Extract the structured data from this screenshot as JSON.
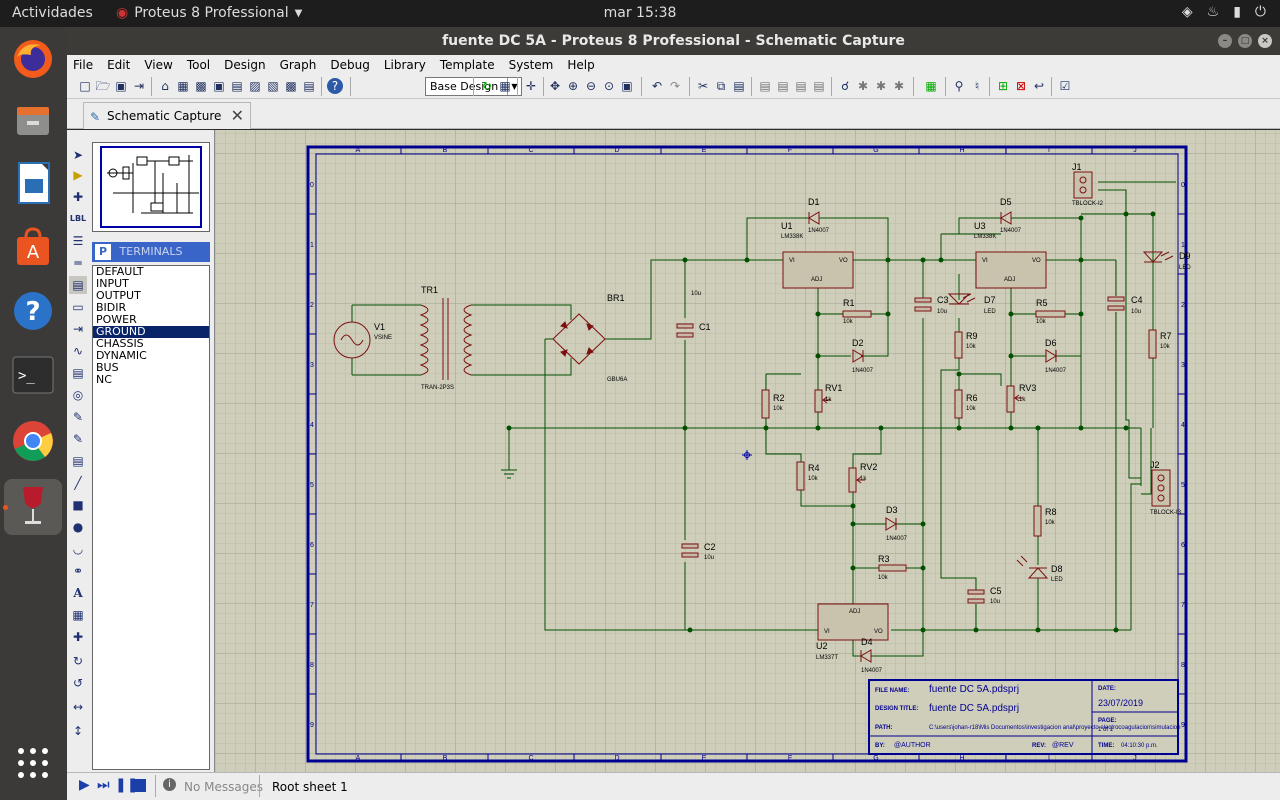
{
  "topbar": {
    "activities": "Actividades",
    "app_name": "Proteus 8 Professional",
    "clock": "mar 15:38",
    "tray_icons": [
      "wifi-icon",
      "volume-icon",
      "battery-icon",
      "power-icon"
    ]
  },
  "dock": {
    "items": [
      "firefox-icon",
      "files-icon",
      "libreoffice-impress-icon",
      "software-center-icon",
      "help-icon",
      "terminal-icon",
      "chrome-icon",
      "wine-icon",
      "app-grid-icon"
    ]
  },
  "window": {
    "title": "fuente DC 5A - Proteus 8 Professional - Schematic Capture"
  },
  "menu": [
    "File",
    "Edit",
    "View",
    "Tool",
    "Design",
    "Graph",
    "Debug",
    "Library",
    "Template",
    "System",
    "Help"
  ],
  "toolbar": {
    "layer_select": "Base Design"
  },
  "tab": {
    "label": "Schematic Capture"
  },
  "panel": {
    "mode_letter": "P",
    "header": "TERMINALS",
    "items": [
      "DEFAULT",
      "INPUT",
      "OUTPUT",
      "BIDIR",
      "POWER",
      "GROUND",
      "CHASSIS",
      "DYNAMIC",
      "BUS",
      "NC"
    ],
    "selected": "GROUND"
  },
  "sheet": {
    "col_labels": [
      "A",
      "B",
      "C",
      "D",
      "E",
      "F",
      "G",
      "H",
      "I",
      "J",
      "K"
    ],
    "row_labels": [
      "0",
      "1",
      "2",
      "3",
      "4",
      "5",
      "6",
      "7",
      "8",
      "9"
    ],
    "components": {
      "V1": {
        "ref": "V1",
        "value": "VSINE"
      },
      "TR1": {
        "ref": "TR1",
        "value": "TRAN-2P3S"
      },
      "BR1": {
        "ref": "BR1",
        "value": "GBU6A"
      },
      "C1": {
        "ref": "C1",
        "value": "10u"
      },
      "C2": {
        "ref": "C2",
        "value": "10u"
      },
      "C3": {
        "ref": "C3",
        "value": "10u"
      },
      "C4": {
        "ref": "C4",
        "value": "10u"
      },
      "C5": {
        "ref": "C5",
        "value": "10u"
      },
      "U1": {
        "ref": "U1",
        "value": "LM338K",
        "pin_vi": "VI",
        "pin_vo": "VO",
        "pin_adj": "ADJ"
      },
      "U2": {
        "ref": "U2",
        "value": "LM337T",
        "pin_vi": "VI",
        "pin_vo": "VO",
        "pin_adj": "ADJ"
      },
      "U3": {
        "ref": "U3",
        "value": "LM338K",
        "pin_vi": "VI",
        "pin_vo": "VO",
        "pin_adj": "ADJ"
      },
      "D1": {
        "ref": "D1",
        "value": "1N4007"
      },
      "D2": {
        "ref": "D2",
        "value": "1N4007"
      },
      "D3": {
        "ref": "D3",
        "value": "1N4007"
      },
      "D4": {
        "ref": "D4",
        "value": "1N4007"
      },
      "D5": {
        "ref": "D5",
        "value": "1N4007"
      },
      "D6": {
        "ref": "D6",
        "value": "1N4007"
      },
      "D7": {
        "ref": "D7",
        "value": "LED"
      },
      "D8": {
        "ref": "D8",
        "value": "LED"
      },
      "D9": {
        "ref": "D9",
        "value": "LED"
      },
      "R1": {
        "ref": "R1",
        "value": "10k"
      },
      "R2": {
        "ref": "R2",
        "value": "10k"
      },
      "R3": {
        "ref": "R3",
        "value": "10k"
      },
      "R4": {
        "ref": "R4",
        "value": "10k"
      },
      "R5": {
        "ref": "R5",
        "value": "10k"
      },
      "R6": {
        "ref": "R6",
        "value": "10k"
      },
      "R7": {
        "ref": "R7",
        "value": "10k"
      },
      "R8": {
        "ref": "R8",
        "value": "10k"
      },
      "R9": {
        "ref": "R9",
        "value": "10k"
      },
      "RV1": {
        "ref": "RV1",
        "value": "1k"
      },
      "RV2": {
        "ref": "RV2",
        "value": "1k"
      },
      "RV3": {
        "ref": "RV3",
        "value": "1k"
      },
      "J1": {
        "ref": "J1",
        "value": "TBLOCK-I2"
      },
      "J2": {
        "ref": "J2",
        "value": "TBLOCK-I3"
      }
    },
    "titleblock": {
      "file_name_label": "FILE NAME:",
      "file_name": "fuente DC 5A.pdsprj",
      "design_title_label": "DESIGN TITLE:",
      "design_title": "fuente DC 5A.pdsprj",
      "path_label": "PATH:",
      "path": "C:\\users\\johan-r18\\Mis Documentos\\investigacion anal\\proyecto electrocoagulacion\\simulacion",
      "by_label": "BY:",
      "by": "@AUTHOR",
      "rev_label": "REV:",
      "rev": "@REV",
      "date_label": "DATE:",
      "date": "23/07/2019",
      "page_label": "PAGE:",
      "page": "1 of 1",
      "time_label": "TIME:",
      "time": "04:10:30 p.m."
    }
  },
  "status": {
    "messages": "No Messages",
    "sheet": "Root sheet 1"
  }
}
